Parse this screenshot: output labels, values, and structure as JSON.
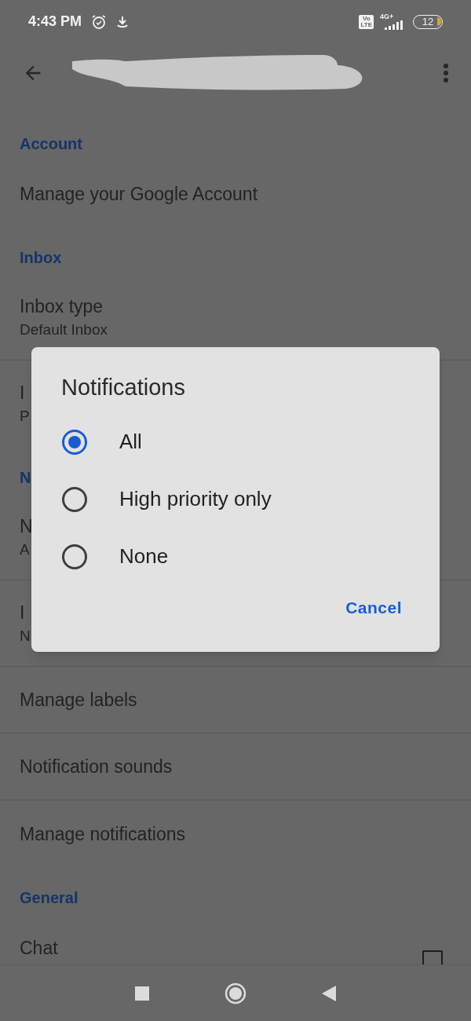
{
  "status_bar": {
    "time": "4:43 PM",
    "volte_top": "Vo",
    "volte_bottom": "LTE",
    "network": "4G+",
    "battery": "12"
  },
  "sections": [
    {
      "header": "Account",
      "items": [
        {
          "kind": "link",
          "title": "Manage your Google Account"
        }
      ]
    },
    {
      "header": "Inbox",
      "items": [
        {
          "kind": "link",
          "title": "Inbox type",
          "subtitle": "Default Inbox"
        },
        {
          "kind": "link",
          "title": "I",
          "subtitle": "P"
        }
      ]
    },
    {
      "header": "N",
      "items": [
        {
          "kind": "link",
          "title": "N",
          "subtitle": "A"
        },
        {
          "kind": "link",
          "title": "I",
          "subtitle": "N"
        },
        {
          "kind": "link",
          "title": "Manage labels"
        },
        {
          "kind": "link",
          "title": "Notification sounds"
        },
        {
          "kind": "link",
          "title": "Manage notifications"
        }
      ]
    },
    {
      "header": "General",
      "items": [
        {
          "kind": "checkbox",
          "title": "Chat",
          "checked": false
        }
      ]
    }
  ],
  "dialog": {
    "title": "Notifications",
    "options": [
      {
        "label": "All",
        "selected": true
      },
      {
        "label": "High priority only",
        "selected": false
      },
      {
        "label": "None",
        "selected": false
      }
    ],
    "buttons": [
      "Cancel"
    ]
  }
}
